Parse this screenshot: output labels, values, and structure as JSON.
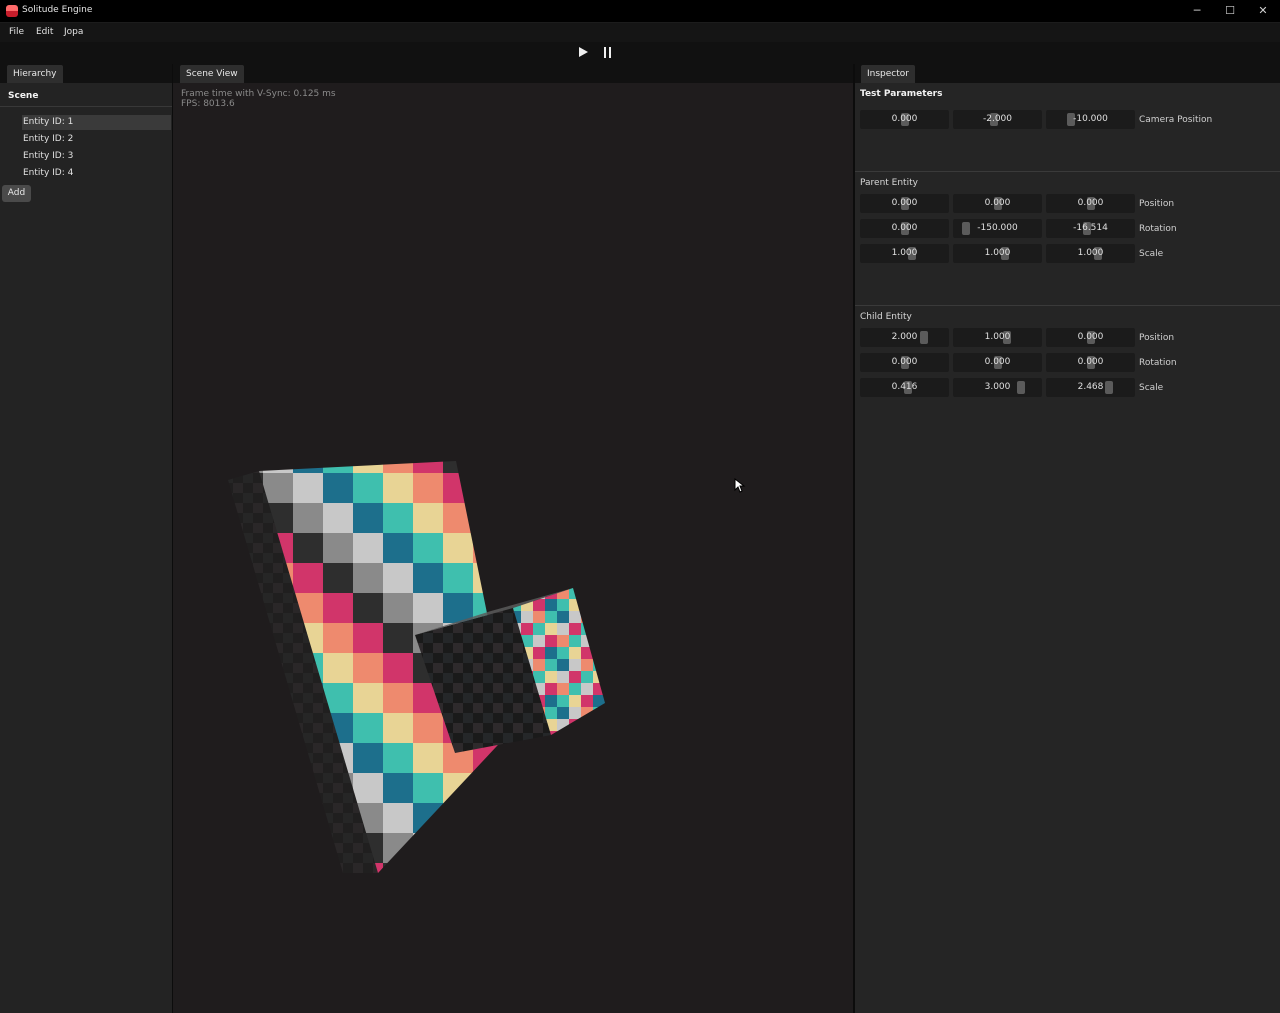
{
  "window": {
    "title": "Solitude Engine",
    "controls": {
      "minimize": "─",
      "maximize": "☐",
      "close": "✕"
    }
  },
  "menu": {
    "items": [
      "File",
      "Edit",
      "Jopa"
    ]
  },
  "toolbar": {
    "play_icon": "play-icon",
    "pause_icon": "pause-icon"
  },
  "hierarchy": {
    "tab": "Hierarchy",
    "scene_label": "Scene",
    "entities": [
      "Entity ID: 1",
      "Entity ID: 2",
      "Entity ID: 3",
      "Entity ID: 4"
    ],
    "selected_index": 0,
    "add_label": "Add"
  },
  "scene_view": {
    "tab": "Scene View",
    "frame_time": "Frame time with V-Sync: 0.125 ms",
    "fps": "FPS: 8013.6"
  },
  "inspector": {
    "tab": "Inspector",
    "test_parameters": {
      "title": "Test Parameters",
      "camera_position": {
        "label": "Camera Position",
        "values": [
          "0.000",
          "-2.000",
          "-10.000"
        ]
      }
    },
    "parent_entity": {
      "title": "Parent Entity",
      "position": {
        "label": "Position",
        "values": [
          "0.000",
          "0.000",
          "0.000"
        ]
      },
      "rotation": {
        "label": "Rotation",
        "values": [
          "0.000",
          "-150.000",
          "-16.514"
        ]
      },
      "scale": {
        "label": "Scale",
        "values": [
          "1.000",
          "1.000",
          "1.000"
        ]
      }
    },
    "child_entity": {
      "title": "Child Entity",
      "position": {
        "label": "Position",
        "values": [
          "2.000",
          "1.000",
          "0.000"
        ]
      },
      "rotation": {
        "label": "Rotation",
        "values": [
          "0.000",
          "0.000",
          "0.000"
        ]
      },
      "scale": {
        "label": "Scale",
        "values": [
          "0.416",
          "3.000",
          "2.468"
        ]
      }
    }
  },
  "colors": {
    "texture_palette": [
      "#1d6f8c",
      "#3fbfae",
      "#e8d495",
      "#ee8a6e",
      "#d1356a",
      "#2e2e2e",
      "#8a8a8a",
      "#c8c8c8"
    ]
  }
}
